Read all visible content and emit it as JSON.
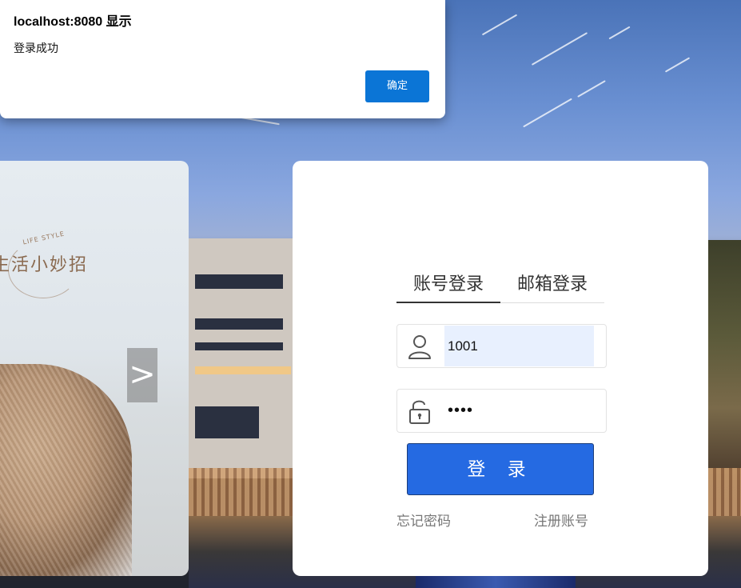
{
  "dialog": {
    "title": "localhost:8080 显示",
    "message": "登录成功",
    "ok_label": "确定"
  },
  "carousel": {
    "brand_small": "LIFE STYLE",
    "brand_title": "生活小妙招",
    "next_label": ">"
  },
  "login": {
    "tabs": [
      {
        "label": "账号登录",
        "active": true
      },
      {
        "label": "邮箱登录",
        "active": false
      }
    ],
    "username": {
      "value": "1001",
      "icon": "user-icon"
    },
    "password": {
      "value": "••••",
      "icon": "lock-icon"
    },
    "submit_label": "登 录",
    "forgot_label": "忘记密码",
    "register_label": "注册账号"
  },
  "colors": {
    "primary": "#256ae2",
    "dialog_button": "#0b75d6"
  }
}
